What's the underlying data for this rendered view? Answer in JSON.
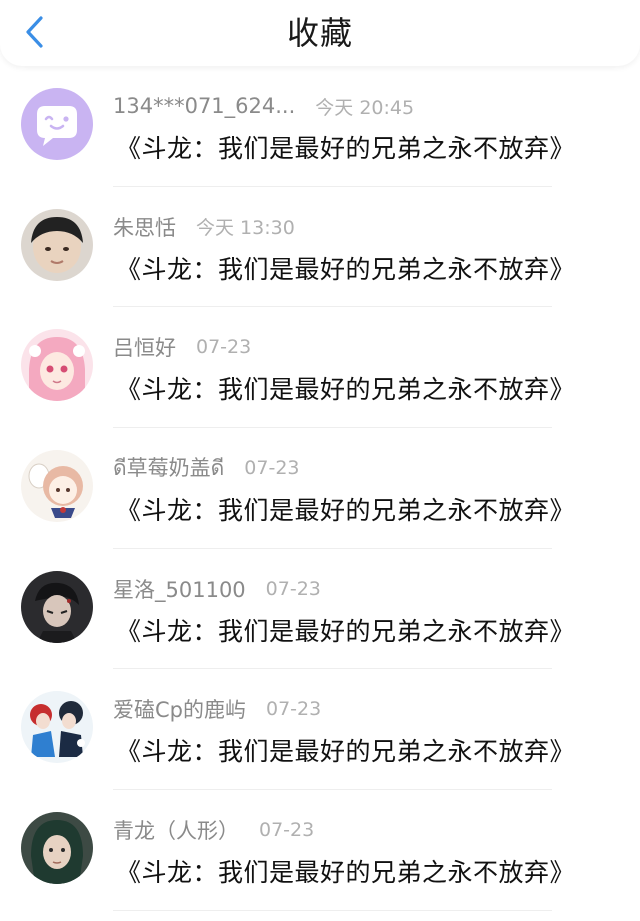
{
  "header": {
    "title": "收藏",
    "back_icon": "chevron-left-icon",
    "accent_color": "#3a8ee6"
  },
  "items": [
    {
      "name": "134***071_624...",
      "time": "今天 20:45",
      "text": "《斗龙：我们是最好的兄弟之永不放弃》",
      "avatar": "default-chat-avatar"
    },
    {
      "name": "朱思恬",
      "time": "今天 13:30",
      "text": "《斗龙：我们是最好的兄弟之永不放弃》",
      "avatar": "child-photo-avatar"
    },
    {
      "name": "吕恒好",
      "time": "07-23",
      "text": "《斗龙：我们是最好的兄弟之永不放弃》",
      "avatar": "pink-anime-avatar"
    },
    {
      "name": "ดี草莓奶盖ดี",
      "time": "07-23",
      "text": "《斗龙：我们是最好的兄弟之永不放弃》",
      "avatar": "chibi-girl-avatar"
    },
    {
      "name": "星洛_501100",
      "time": "07-23",
      "text": "《斗龙：我们是最好的兄弟之永不放弃》",
      "avatar": "dark-anime-avatar"
    },
    {
      "name": "爱磕Cp的鹿屿",
      "time": "07-23",
      "text": "《斗龙：我们是最好的兄弟之永不放弃》",
      "avatar": "couple-anime-avatar"
    },
    {
      "name": "青龙（人形）",
      "time": "07-23",
      "text": "《斗龙：我们是最好的兄弟之永不放弃》",
      "avatar": "green-hair-avatar"
    }
  ]
}
